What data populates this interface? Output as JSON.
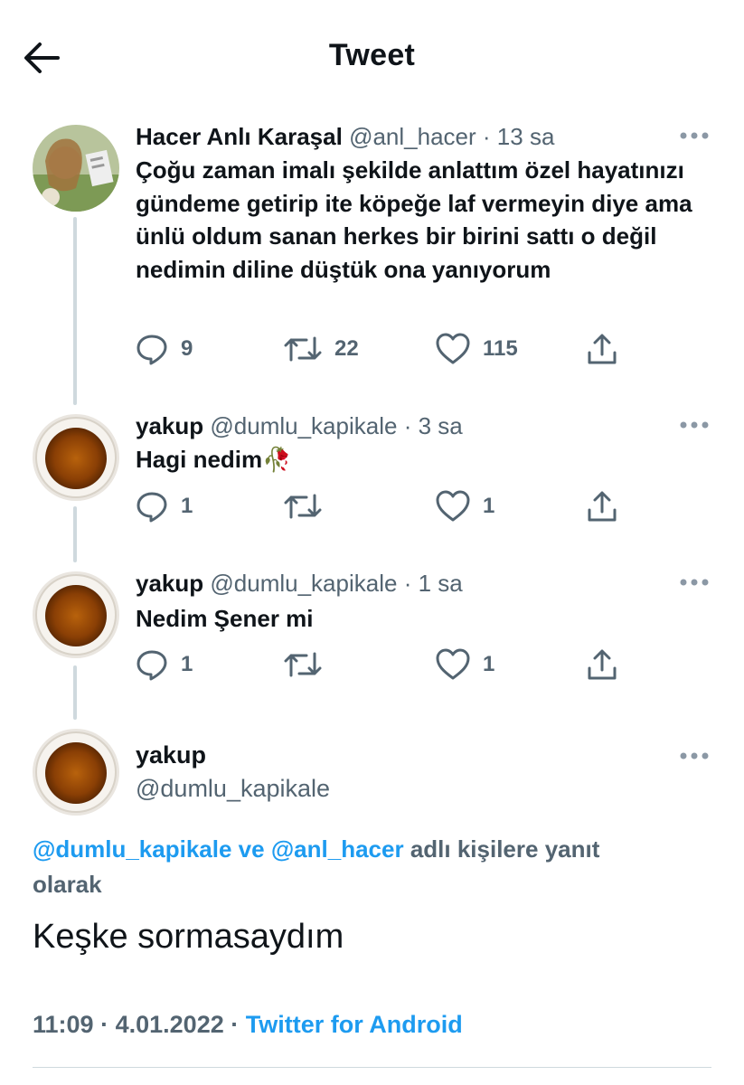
{
  "header": {
    "title": "Tweet",
    "back_icon": "arrow-left-icon"
  },
  "thread": [
    {
      "name": "Hacer Anlı Karaşal",
      "handle": "@anl_hacer",
      "time": "13 sa",
      "text": "Çoğu zaman imalı şekilde anlattım özel hayatınızı gündeme getirip ite köpeğe laf vermeyin diye ama ünlü oldum sanan herkes bir birini sattı o değil nedimin diline düştük ona yanıyorum",
      "replies": "9",
      "retweets": "22",
      "likes": "115"
    },
    {
      "name": "yakup",
      "handle": "@dumlu_kapikale",
      "time": "3 sa",
      "text": "Hagi nedim🥀",
      "replies": "1",
      "retweets": "",
      "likes": "1"
    },
    {
      "name": "yakup",
      "handle": "@dumlu_kapikale",
      "time": "1 sa",
      "text": "Nedim Şener mi",
      "replies": "1",
      "retweets": "",
      "likes": "1"
    }
  ],
  "main_tweet": {
    "name": "yakup",
    "handle": "@dumlu_kapikale",
    "reply_to": {
      "mention1": "@dumlu_kapikale",
      "connector": "ve",
      "mention2": "@anl_hacer",
      "suffix": "adlı kişilere yanıt olarak"
    },
    "text": "Keşke sormasaydım",
    "time": "11:09",
    "date": "4.01.2022",
    "source": "Twitter for Android"
  },
  "separator": "·",
  "colors": {
    "text": "#0f1419",
    "secondary": "#536471",
    "link": "#1d9bf0",
    "thread_line": "#cfd9de"
  }
}
